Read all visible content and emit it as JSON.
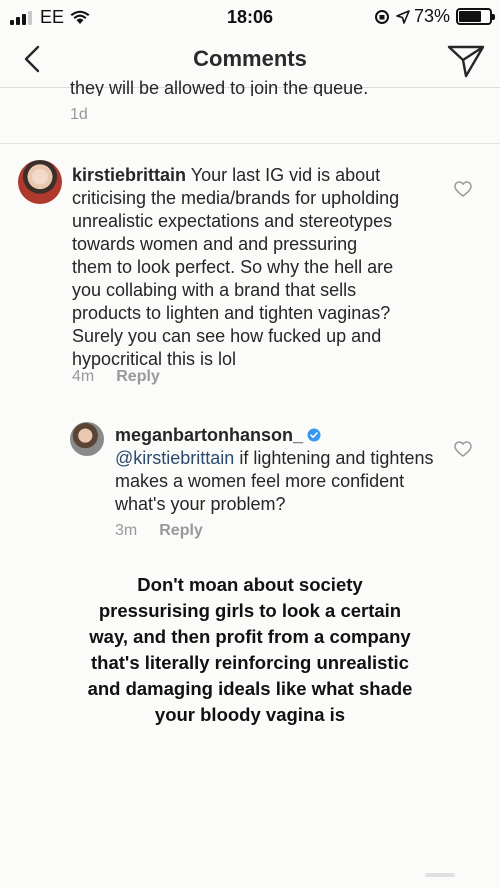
{
  "status_bar": {
    "carrier": "EE",
    "time": "18:06",
    "battery_percent": "73%",
    "battery_level": 0.73
  },
  "header": {
    "title": "Comments"
  },
  "previous_comment": {
    "clipped_text": "they will be allowed to join the queue.",
    "age": "1d"
  },
  "comments": [
    {
      "username": "kirstiebrittain",
      "text": "Your last IG vid is about criticising the media/brands for upholding unrealistic expectations and stereotypes towards women and and pressuring them to look perfect. So why the hell are you collabing with a brand that sells products to lighten and tighten vaginas? Surely you can see how fucked up and hypocritical this is lol",
      "age": "4m",
      "reply_label": "Reply"
    },
    {
      "username": "meganbartonhanson_",
      "mention": "@kirstiebrittain",
      "text": "if lightening and tightens makes a women feel more confident what's your problem?",
      "age": "3m",
      "reply_label": "Reply"
    }
  ],
  "overlay_caption": "Don't moan about society pressurising girls to look a certain way, and then profit from a company that's literally reinforcing unrealistic and damaging ideals like what shade your bloody vagina is",
  "colors": {
    "accent_link": "#2c4a6e",
    "verified_blue": "#3897f0",
    "meta_gray": "#999999"
  }
}
